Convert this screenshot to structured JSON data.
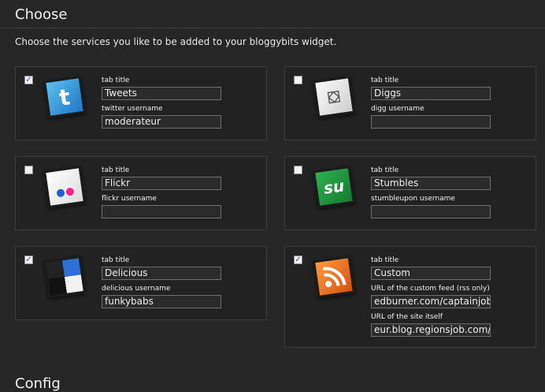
{
  "page": {
    "title": "Choose",
    "intro": "Choose the services you like to be added to your bloggybits widget.",
    "next_section_title": "Config"
  },
  "services": [
    {
      "id": "twitter",
      "checked": true,
      "icon": "twitter-icon",
      "tab_title_label": "tab title",
      "tab_title": "Tweets",
      "field_label": "twitter username",
      "field_value": "moderateur"
    },
    {
      "id": "digg",
      "checked": false,
      "icon": "digg-icon",
      "tab_title_label": "tab title",
      "tab_title": "Diggs",
      "field_label": "digg username",
      "field_value": ""
    },
    {
      "id": "flickr",
      "checked": false,
      "icon": "flickr-icon",
      "tab_title_label": "tab title",
      "tab_title": "Flickr",
      "field_label": "flickr username",
      "field_value": ""
    },
    {
      "id": "stumbleupon",
      "checked": false,
      "icon": "stumbleupon-icon",
      "tab_title_label": "tab title",
      "tab_title": "Stumbles",
      "field_label": "stumbleupon username",
      "field_value": ""
    },
    {
      "id": "delicious",
      "checked": true,
      "icon": "delicious-icon",
      "tab_title_label": "tab title",
      "tab_title": "Delicious",
      "field_label": "delicious username",
      "field_value": "funkybabs"
    },
    {
      "id": "custom",
      "checked": true,
      "icon": "rss-icon",
      "tab_title_label": "tab title",
      "tab_title": "Custom",
      "field_label": "URL of the custom feed (rss only)",
      "field_value": "edburner.com/captainjob",
      "field2_label": "URL of the site itself",
      "field2_value": "eur.blog.regionsjob.com/"
    }
  ],
  "colors": {
    "background": "#262626",
    "card_border": "#3c3c3c",
    "twitter": "#2b8fd6",
    "stumbleupon": "#1f8a3a",
    "rss": "#e0651b"
  }
}
